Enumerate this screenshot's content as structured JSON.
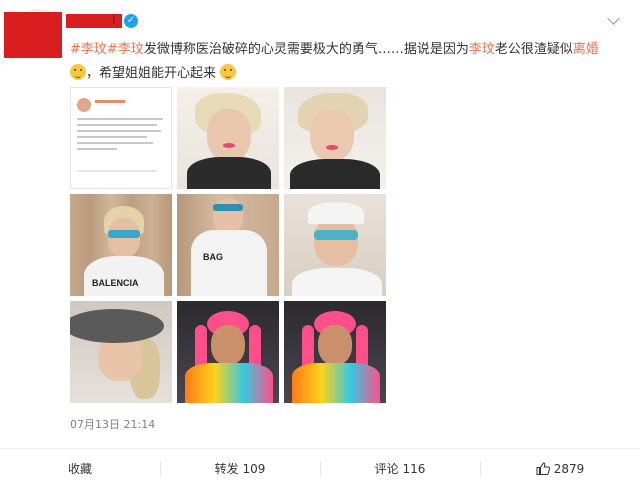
{
  "header": {
    "username_tail": "i",
    "verified_mark": "✓"
  },
  "post": {
    "line1": {
      "hashtag1": "#李玟",
      "hashtag2": "#李玟",
      "text1": "发微博称医治破碎的心灵需要极大的勇气……据说是因为",
      "name": "李玟",
      "text2": "老公很渣疑似",
      "keyword": "离婚"
    },
    "line2": {
      "text": "，希望姐姐能开心起来"
    },
    "images": [
      {
        "name": "image-screenshot-post"
      },
      {
        "name": "image-blonde-selfie"
      },
      {
        "name": "image-blonde-pose"
      },
      {
        "name": "image-curtain-sunglasses",
        "overlay": "BALENCIA"
      },
      {
        "name": "image-white-top-sunglasses",
        "overlay": "BAG"
      },
      {
        "name": "image-cap-sunglasses"
      },
      {
        "name": "image-sunhat-lying"
      },
      {
        "name": "image-pink-braids-1"
      },
      {
        "name": "image-pink-braids-2"
      }
    ],
    "timestamp": "07月13日 21:14"
  },
  "actions": {
    "favorite": "收藏",
    "repost": "转发 109",
    "comment": "评论 116",
    "like": "2879"
  },
  "colors": {
    "hashtag": "#eb7350",
    "redaction": "#d81e1e",
    "verified": "#1da1f2"
  },
  "icons": {
    "verified": "verified-badge-icon",
    "more": "chevron-down-icon",
    "like": "thumbs-up-icon"
  }
}
